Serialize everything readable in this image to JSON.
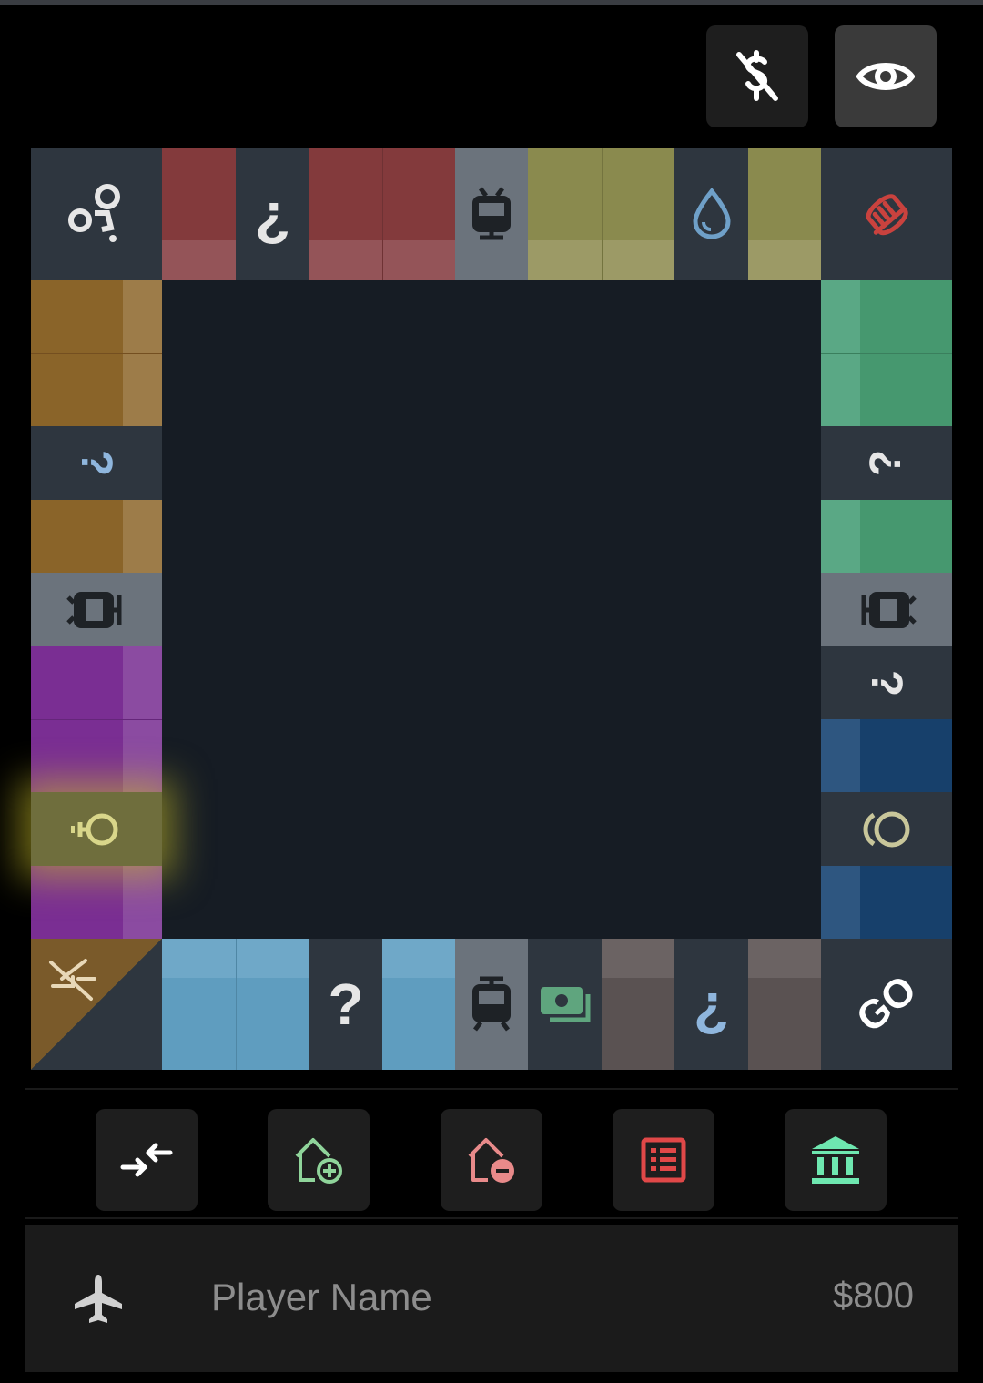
{
  "top_buttons": {
    "no_money_icon": "dollar-off-icon",
    "visibility_icon": "eye-icon"
  },
  "board": {
    "top_row": [
      {
        "kind": "corner",
        "icon": "free-parking-icon"
      },
      {
        "kind": "property",
        "color": "#833a3c"
      },
      {
        "kind": "chance",
        "glyph": "¿"
      },
      {
        "kind": "property",
        "color": "#833a3c"
      },
      {
        "kind": "property",
        "color": "#833a3c"
      },
      {
        "kind": "railroad",
        "icon": "train-icon"
      },
      {
        "kind": "property",
        "color": "#8a8a4e"
      },
      {
        "kind": "property",
        "color": "#8a8a4e"
      },
      {
        "kind": "utility",
        "icon": "water-drop-icon"
      },
      {
        "kind": "property",
        "color": "#8a8a4e"
      },
      {
        "kind": "corner",
        "icon": "go-to-jail-icon"
      }
    ],
    "go_label": "GO"
  },
  "action_buttons": [
    {
      "name": "trade-button",
      "icon": "swap-arrows-icon"
    },
    {
      "name": "add-house-button",
      "icon": "house-plus-icon"
    },
    {
      "name": "remove-house-button",
      "icon": "house-minus-icon"
    },
    {
      "name": "property-list-button",
      "icon": "list-icon"
    },
    {
      "name": "bank-button",
      "icon": "bank-icon"
    }
  ],
  "player": {
    "token_icon": "airplane-icon",
    "name_placeholder": "Player Name",
    "money": "$800"
  },
  "colors": {
    "red": "#833a3c",
    "yellow": "#8a8a4e",
    "green": "#46986f",
    "blue": "#17406b",
    "orange": "#8a6429",
    "purple": "#7a2e93",
    "lightblue": "#5f9dbf",
    "brown": "#5a5252"
  }
}
